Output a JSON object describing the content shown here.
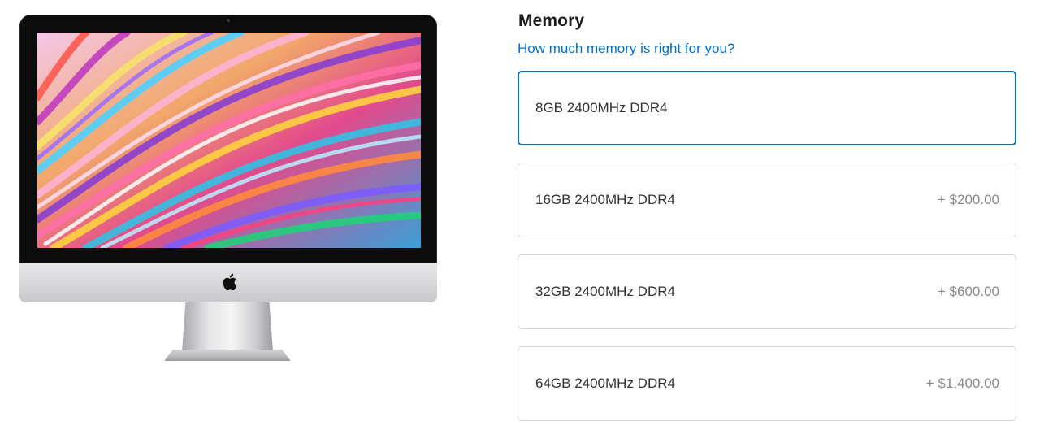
{
  "product": {
    "image_alt_icon": "apple-logo-icon"
  },
  "memory": {
    "title": "Memory",
    "help_link": "How much memory is right for you?",
    "options": [
      {
        "label": "8GB 2400MHz DDR4",
        "price": "",
        "selected": true
      },
      {
        "label": "16GB 2400MHz DDR4",
        "price": "+ $200.00",
        "selected": false
      },
      {
        "label": "32GB 2400MHz DDR4",
        "price": "+ $600.00",
        "selected": false
      },
      {
        "label": "64GB 2400MHz DDR4",
        "price": "+ $1,400.00",
        "selected": false
      }
    ]
  },
  "colors": {
    "accent": "#0070c9",
    "border": "#d6d6d6",
    "text": "#1d1d1f",
    "price_text": "#888888"
  }
}
